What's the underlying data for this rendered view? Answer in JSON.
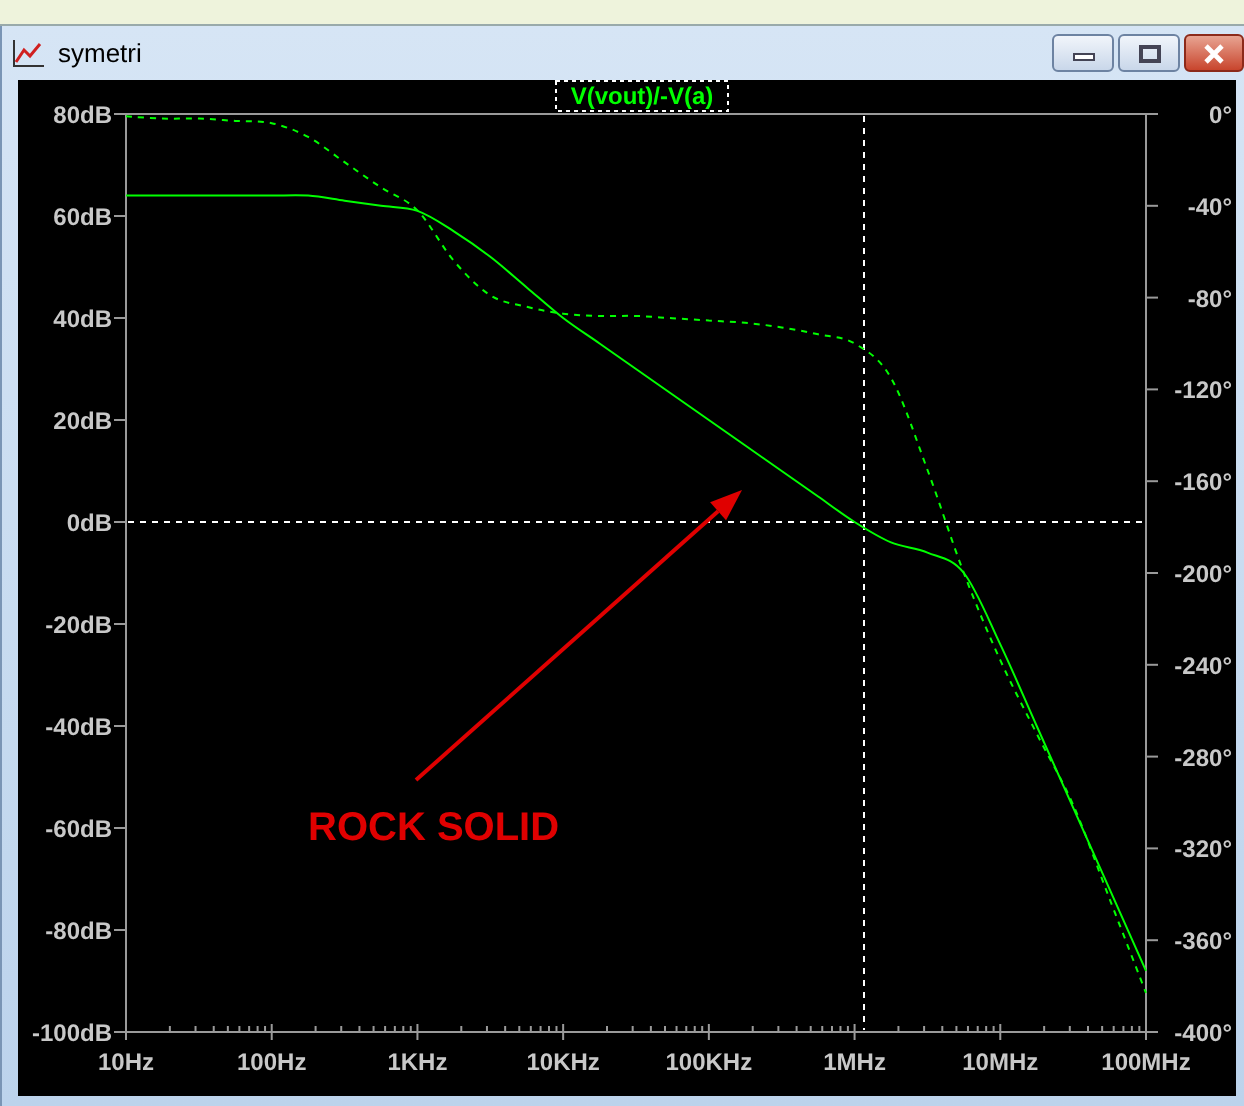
{
  "window": {
    "title": "symetri"
  },
  "plot": {
    "trace_label": "V(vout)/-V(a)",
    "chart_data": {
      "type": "line",
      "categories": [
        "10Hz",
        null,
        null,
        null,
        "100Hz",
        null,
        null,
        null,
        "1KHz",
        null,
        null,
        null,
        "10KHz",
        null,
        null,
        null,
        "100KHz",
        null,
        null,
        null,
        "1MHz",
        null,
        null,
        null,
        "10MHz",
        null,
        null,
        null,
        "100MHz"
      ],
      "ylim": [
        -100,
        80
      ],
      "y2lim": [
        -400,
        0
      ],
      "yticks": [
        {
          "value": 80,
          "label": "80dB"
        },
        {
          "value": 60,
          "label": "60dB"
        },
        {
          "value": 40,
          "label": "40dB"
        },
        {
          "value": 20,
          "label": "20dB"
        },
        {
          "value": 0,
          "label": "0dB"
        },
        {
          "value": -20,
          "label": "-20dB"
        },
        {
          "value": -40,
          "label": "-40dB"
        },
        {
          "value": -60,
          "label": "-60dB"
        },
        {
          "value": -80,
          "label": "-80dB"
        },
        {
          "value": -100,
          "label": "-100dB"
        }
      ],
      "y2ticks": [
        {
          "value": 0,
          "label": "0°"
        },
        {
          "value": -40,
          "label": "-40°"
        },
        {
          "value": -80,
          "label": "-80°"
        },
        {
          "value": -120,
          "label": "-120°"
        },
        {
          "value": -160,
          "label": "-160°"
        },
        {
          "value": -200,
          "label": "-200°"
        },
        {
          "value": -240,
          "label": "-240°"
        },
        {
          "value": -280,
          "label": "-280°"
        },
        {
          "value": -320,
          "label": "-320°"
        },
        {
          "value": -360,
          "label": "-360°"
        },
        {
          "value": -400,
          "label": "-400°"
        }
      ],
      "series": [
        {
          "color": "#00ff00",
          "line_style": "solid",
          "values": [
            64,
            64,
            64,
            64,
            64,
            64,
            63,
            62,
            61,
            57,
            52,
            46,
            40,
            35,
            30,
            25,
            20,
            15,
            10,
            5,
            0,
            -4,
            -6,
            -10,
            -24,
            -40,
            -56,
            -72,
            -88
          ]
        },
        {
          "color": "#00ff00",
          "axis": "y2",
          "line_style": "dashed",
          "values": [
            -1,
            -2,
            -2,
            -3,
            -4,
            -10,
            -21,
            -32,
            -42,
            -64,
            -79,
            -84,
            -87,
            -88,
            -88,
            -89,
            -90,
            -91,
            -93,
            -96,
            -100,
            -115,
            -155,
            -200,
            -238,
            -270,
            -301,
            -342,
            -383
          ]
        }
      ],
      "annotations": [
        "ROCK SOLID"
      ]
    }
  }
}
